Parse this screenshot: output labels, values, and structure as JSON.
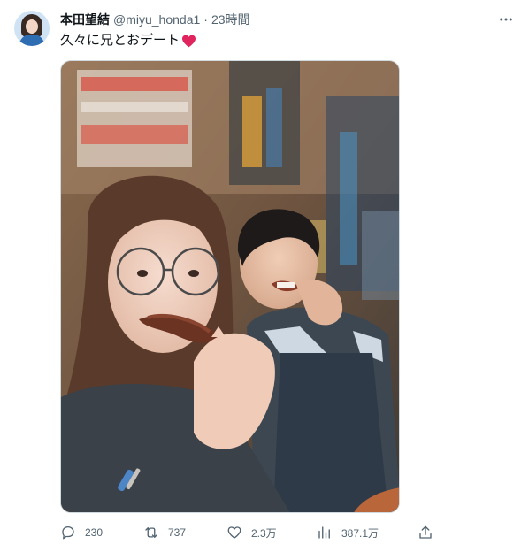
{
  "tweet": {
    "display_name": "本田望結",
    "handle": "@miyu_honda1",
    "separator": "·",
    "time": "23時間",
    "text": "久々に兄とおデート",
    "emoji": "heart-emoji",
    "more_icon": "more-horizontal-icon"
  },
  "actions": {
    "reply_count": "230",
    "retweet_count": "737",
    "like_count": "2.3万",
    "view_count": "387.1万",
    "icons": [
      "reply-icon",
      "retweet-icon",
      "like-icon",
      "views-icon",
      "share-icon"
    ]
  },
  "colors": {
    "text_primary": "#0f1419",
    "text_secondary": "#536471",
    "heart": "#e0245e",
    "border": "#cfd9de"
  }
}
